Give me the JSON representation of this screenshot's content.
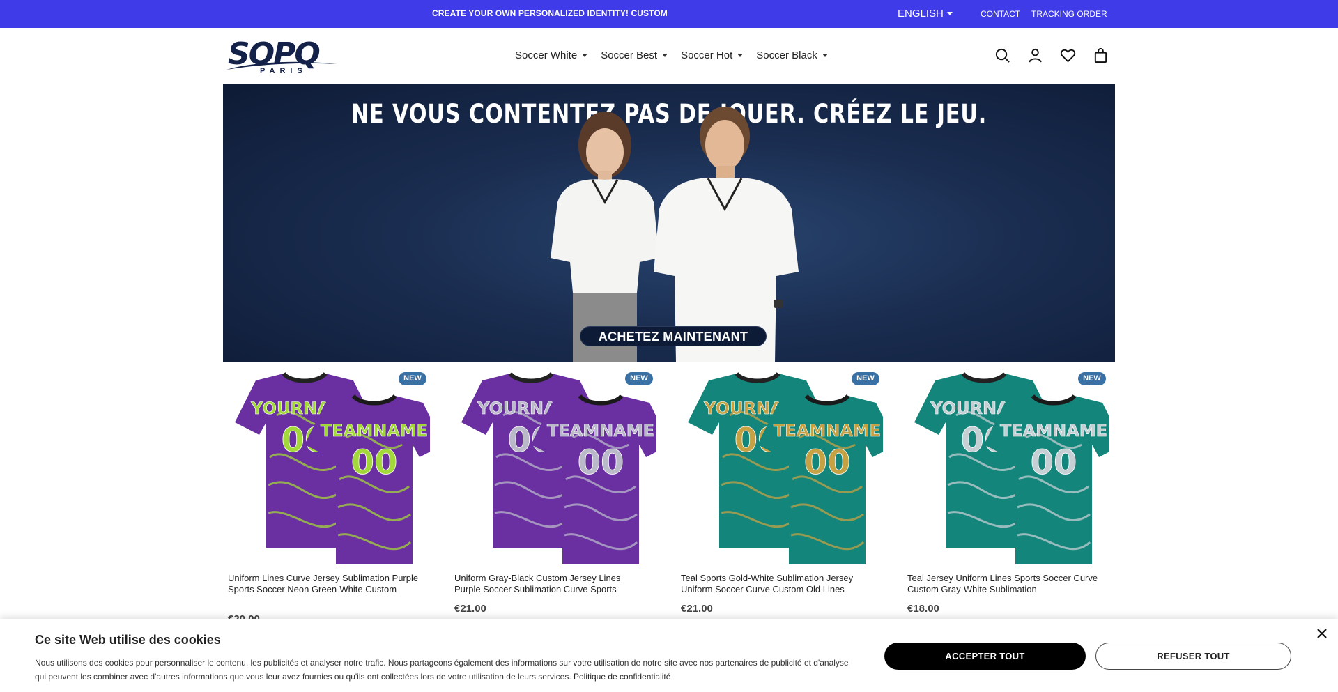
{
  "topbar": {
    "promo": "CREATE YOUR OWN PERSONALIZED IDENTITY! CUSTOM S",
    "language": "ENGLISH",
    "contact": "CONTACT",
    "tracking": "TRACKING ORDER",
    "background": "#3f3be9"
  },
  "header": {
    "logo_brand": "SOPQ",
    "logo_sub": "PARIS",
    "nav": [
      {
        "label": "Soccer White"
      },
      {
        "label": "Soccer Best"
      },
      {
        "label": "Soccer Hot"
      },
      {
        "label": "Soccer Black"
      }
    ],
    "icons": [
      "search-icon",
      "account-icon",
      "wishlist-heart-icon",
      "cart-bag-icon"
    ]
  },
  "hero": {
    "headline": "NE VOUS CONTENTEZ PAS DE JOUER. CRÉEZ LE JEU.",
    "cta": "ACHETEZ MAINTENANT"
  },
  "products": [
    {
      "badge": "NEW",
      "title": "Uniform Lines Curve Jersey Sublimation Purple Sports Soccer Neon Green-White Custom",
      "price": "€20.00",
      "base": "#6a2fa0",
      "accent": "#a3d83a"
    },
    {
      "badge": "NEW",
      "title": "Uniform Gray-Black Custom Jersey Lines Purple Soccer Sublimation Curve Sports",
      "price": "€21.00",
      "base": "#6a2fa0",
      "accent": "#b9b9c9"
    },
    {
      "badge": "NEW",
      "title": "Teal Sports Gold-White Sublimation Jersey Uniform Soccer Curve Custom Old Lines",
      "price": "€21.00",
      "base": "#13857a",
      "accent": "#c7a244"
    },
    {
      "badge": "NEW",
      "title": "Teal Jersey Uniform Lines Sports Soccer Curve Custom Gray-White Sublimation",
      "price": "€18.00",
      "base": "#13857a",
      "accent": "#c5cfd4"
    }
  ],
  "jersey_print": {
    "name_front": "YOURNAME",
    "name_back": "TEAMNAME",
    "number": "00"
  },
  "cookie": {
    "title": "Ce site Web utilise des cookies",
    "text": "Nous utilisons des cookies pour personnaliser le contenu, les publicités et analyser notre trafic. Nous partageons également des informations sur votre utilisation de notre site avec nos partenaires de publicité et d'analyse qui peuvent les combiner avec d'autres informations que vous leur avez fournies ou qu'ils ont collectées lors de votre utilisation de leurs services.",
    "policy_link": "Politique de confidentialité",
    "accept": "ACCEPTER TOUT",
    "refuse": "REFUSER TOUT"
  }
}
